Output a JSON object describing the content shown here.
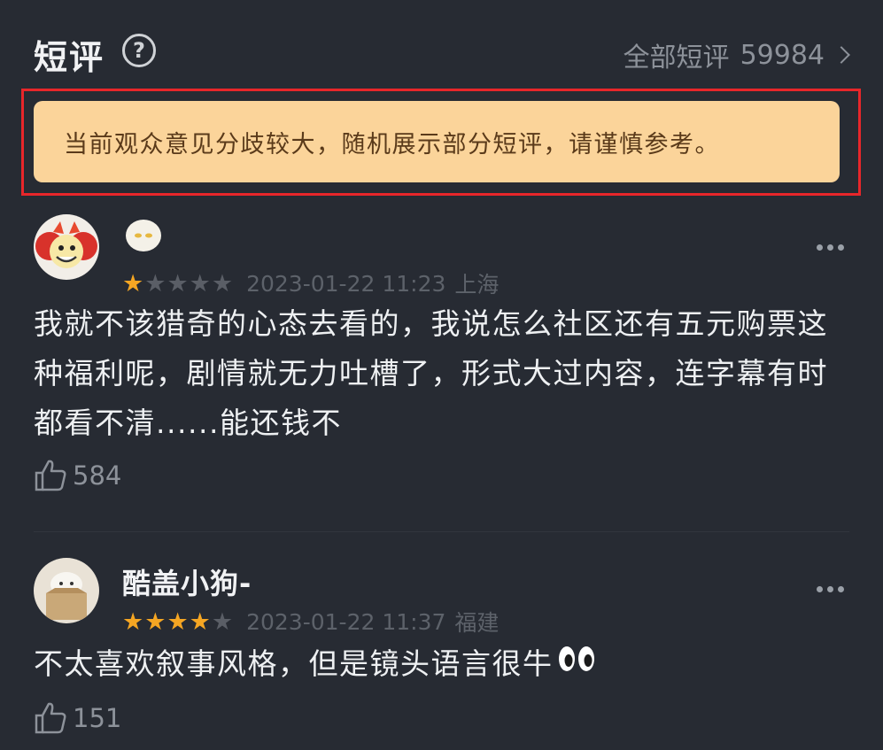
{
  "header": {
    "title": "短评",
    "help_icon": "question-circle-icon",
    "all_reviews_label": "全部短评",
    "all_reviews_count": "59984"
  },
  "notice": {
    "text": "当前观众意见分歧较大，随机展示部分短评，请谨慎参考。",
    "highlight_color": "#e8262a",
    "background_color": "#fbd49a"
  },
  "reviews": [
    {
      "username": "",
      "avatar": "cartoon-avatar-icon",
      "username_icon": "fluffy-emoji-icon",
      "rating": 1,
      "rating_max": 5,
      "date": "2023-01-22 11:23",
      "location": "上海",
      "content": "我就不该猎奇的心态去看的，我说怎么社区还有五元购票这种福利呢，剧情就无力吐槽了，形式大过内容，连字幕有时都看不清......能还钱不",
      "likes": "584"
    },
    {
      "username": "酷盖小狗-",
      "avatar": "dog-in-box-avatar-icon",
      "rating": 4,
      "rating_max": 5,
      "date": "2023-01-22 11:37",
      "location": "福建",
      "content": "不太喜欢叙事风格，但是镜头语言很牛",
      "content_emoji": "eyes-emoji-icon",
      "likes": "151"
    }
  ],
  "colors": {
    "star_on": "#f5a623",
    "star_off": "#5a5e66",
    "background": "#272b33"
  }
}
